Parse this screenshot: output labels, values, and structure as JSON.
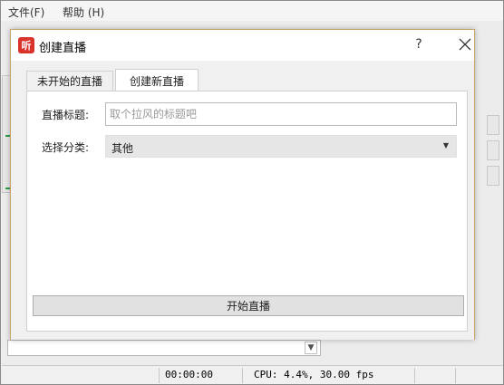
{
  "menubar": {
    "file": "文件(F)",
    "help": "帮助 (H)"
  },
  "statusbar": {
    "time": "00:00:00",
    "cpu": "CPU: 4.4%, 30.00 fps"
  },
  "dialog": {
    "app_icon_text": "听",
    "title": "创建直播",
    "help_label": "?",
    "tabs": [
      {
        "label": "未开始的直播",
        "active": false
      },
      {
        "label": "创建新直播",
        "active": true
      }
    ],
    "form": {
      "title_label": "直播标题:",
      "title_value": "",
      "title_placeholder": "取个拉风的标题吧",
      "category_label": "选择分类:",
      "category_value": "其他"
    },
    "start_button": "开始直播"
  },
  "colors": {
    "accent_border": "#c9a46a",
    "app_icon": "#d9322a",
    "bg_green": "#2e9e3e"
  }
}
